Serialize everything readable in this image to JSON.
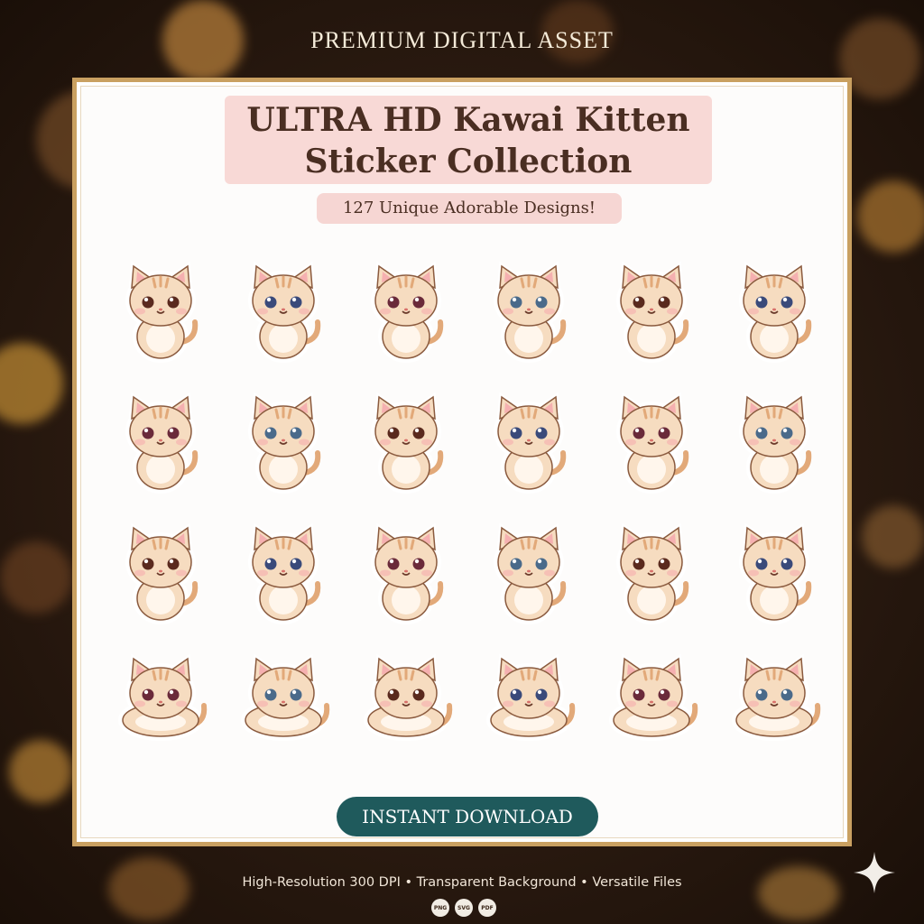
{
  "header": {
    "label": "PREMIUM DIGITAL ASSET"
  },
  "product": {
    "title_line1": "ULTRA HD Kawai Kitten",
    "title_line2": "Sticker Collection",
    "subtitle": "127 Unique Adorable Designs!"
  },
  "stickers": [
    "kitten-sticker",
    "kitten-sticker",
    "kitten-sticker",
    "kitten-sticker",
    "kitten-sticker",
    "kitten-sticker",
    "kitten-sticker",
    "kitten-sticker",
    "kitten-sticker",
    "kitten-sticker",
    "kitten-sticker",
    "kitten-sticker",
    "kitten-sticker",
    "kitten-sticker",
    "kitten-sticker",
    "kitten-sticker",
    "kitten-sticker",
    "kitten-sticker",
    "kitten-sticker",
    "kitten-sticker",
    "kitten-sticker",
    "kitten-sticker",
    "kitten-sticker",
    "kitten-sticker"
  ],
  "cta": {
    "label": "INSTANT DOWNLOAD"
  },
  "footer": {
    "features": "High-Resolution 300 DPI • Transparent Background • Versatile Files",
    "formats": [
      "PNG",
      "SVG",
      "PDF"
    ]
  },
  "colors": {
    "frame": "#c9a061",
    "title_bg": "#f8d9d6",
    "button": "#1f5a5c",
    "background": "#2a1a10",
    "kitten_fur": "#f6dcc0",
    "kitten_stripes": "#e2a979"
  }
}
